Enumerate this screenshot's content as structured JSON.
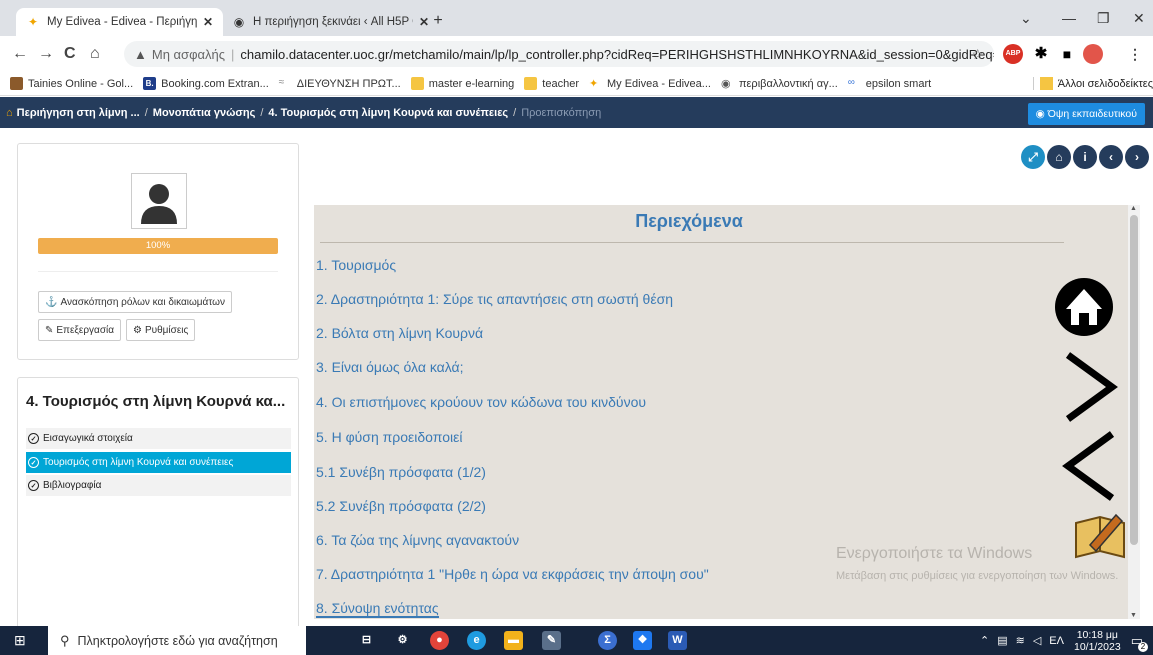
{
  "browser": {
    "tabs": [
      {
        "title": "My Edivea - Edivea - Περιήγηση σ",
        "active": true
      },
      {
        "title": "Η περιήγηση ξεκινάει ‹ All H5P C",
        "active": false
      }
    ],
    "address": {
      "security_label": "Μη ασφαλής",
      "url": "chamilo.datacenter.uoc.gr/metchamilo/main/lp/lp_controller.php?cidReq=PERIHGHSHSTHLIMNHKOYRNA&id_session=0&gidReq=0&gr..."
    },
    "bookmarks": [
      {
        "label": "Tainies Online - Gol...",
        "color": "#8b5a2b"
      },
      {
        "label": "Booking.com Extran...",
        "color": "#1f3d8a",
        "glyph": "B."
      },
      {
        "label": "ΔΙΕΥΘΥΝΣΗ ΠΡΩΤ...",
        "color": "#ffffff"
      },
      {
        "label": "master e-learning",
        "color": "#f5c542"
      },
      {
        "label": "teacher",
        "color": "#f5c542"
      },
      {
        "label": "My Edivea - Edivea...",
        "color": "#ffffff"
      },
      {
        "label": "περιβαλλοντική αγ...",
        "color": "#555555"
      },
      {
        "label": "epsilon smart",
        "color": "#ffffff"
      }
    ],
    "other_bookmarks": "Άλλοι σελιδοδείκτες"
  },
  "breadcrumb": {
    "items": [
      "Περιήγηση στη λίμνη ...",
      "Μονοπάτια γνώσης",
      "4. Τουρισμός στη λίμνη Κουρνά και συνέπειες"
    ],
    "current": "Προεπισκόπηση",
    "teacher_view": "Όψη εκπαιδευτικού"
  },
  "sidebar": {
    "progress": 100,
    "progress_label": "100%",
    "roles_button": "Ανασκόπηση ρόλων και δικαιωμάτων",
    "edit_button": "Επεξεργασία",
    "settings_button": "Ρυθμίσεις",
    "lp_title": "4. Τουρισμός στη λίμνη Κουρνά κα...",
    "items": [
      {
        "label": "Εισαγωγικά στοιχεία"
      },
      {
        "label": "Τουρισμός στη λίμνη Κουρνά και συνέπειες"
      },
      {
        "label": "Βιβλιογραφία"
      }
    ]
  },
  "content": {
    "heading": "Περιεχόμενα",
    "toc": [
      "1. Τουρισμός",
      "2. Δραστηριότητα 1: Σύρε τις απαντήσεις στη σωστή θέση",
      "2. Βόλτα στη λίμνη Κουρνά",
      "3. Είναι όμως όλα καλά;",
      "4. Οι επιστήμονες κρούουν τον κώδωνα του κινδύνου",
      "5. Η φύση προειδοποιεί",
      "5.1 Συνέβη πρόσφατα (1/2)",
      "5.2 Συνέβη πρόσφατα (2/2)",
      "6. Τα ζώα της λίμνης αγανακτούν",
      "7. Δραστηριότητα 1 \"Ηρθε η ώρα να εκφράσεις την άποψη σου\"",
      "8. Σύνοψη ενότητας"
    ],
    "watermark_title": "Ενεργοποιήστε τα Windows",
    "watermark_text": "Μετάβαση στις ρυθμίσεις για ενεργοποίηση των Windows."
  },
  "taskbar": {
    "search_placeholder": "Πληκτρολογήστε εδώ για αναζήτηση",
    "lang": "ΕΛ",
    "time": "10:18 μμ",
    "date": "10/1/2023",
    "notification_count": "2"
  }
}
